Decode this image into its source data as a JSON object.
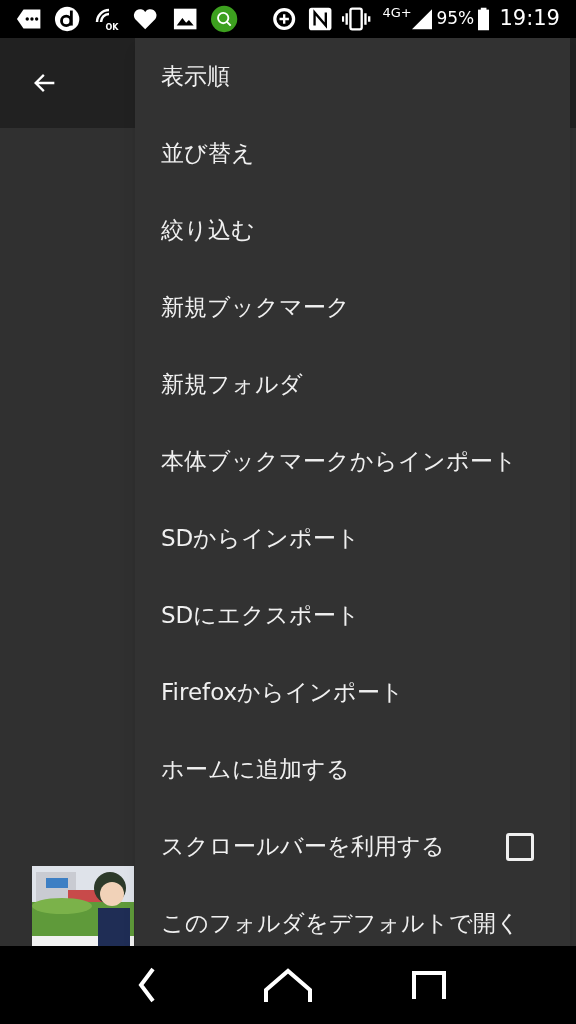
{
  "status_bar": {
    "ok_label": "OK",
    "network": "4G+",
    "battery": "95%",
    "time": "19:19"
  },
  "menu": {
    "items": [
      {
        "kind": "text",
        "label": "表示順"
      },
      {
        "kind": "text",
        "label": "並び替え"
      },
      {
        "kind": "text",
        "label": "絞り込む"
      },
      {
        "kind": "text",
        "label": "新規ブックマーク"
      },
      {
        "kind": "text",
        "label": "新規フォルダ"
      },
      {
        "kind": "text",
        "label": "本体ブックマークからインポート"
      },
      {
        "kind": "text",
        "label": "SDからインポート"
      },
      {
        "kind": "text",
        "label": "SDにエクスポート"
      },
      {
        "kind": "text",
        "label": "Firefoxからインポート"
      },
      {
        "kind": "text",
        "label": "ホームに追加する"
      },
      {
        "kind": "checkbox",
        "label": "スクロールバーを利用する",
        "checked": false
      },
      {
        "kind": "text",
        "label": "このフォルダをデフォルトで開く"
      }
    ]
  }
}
